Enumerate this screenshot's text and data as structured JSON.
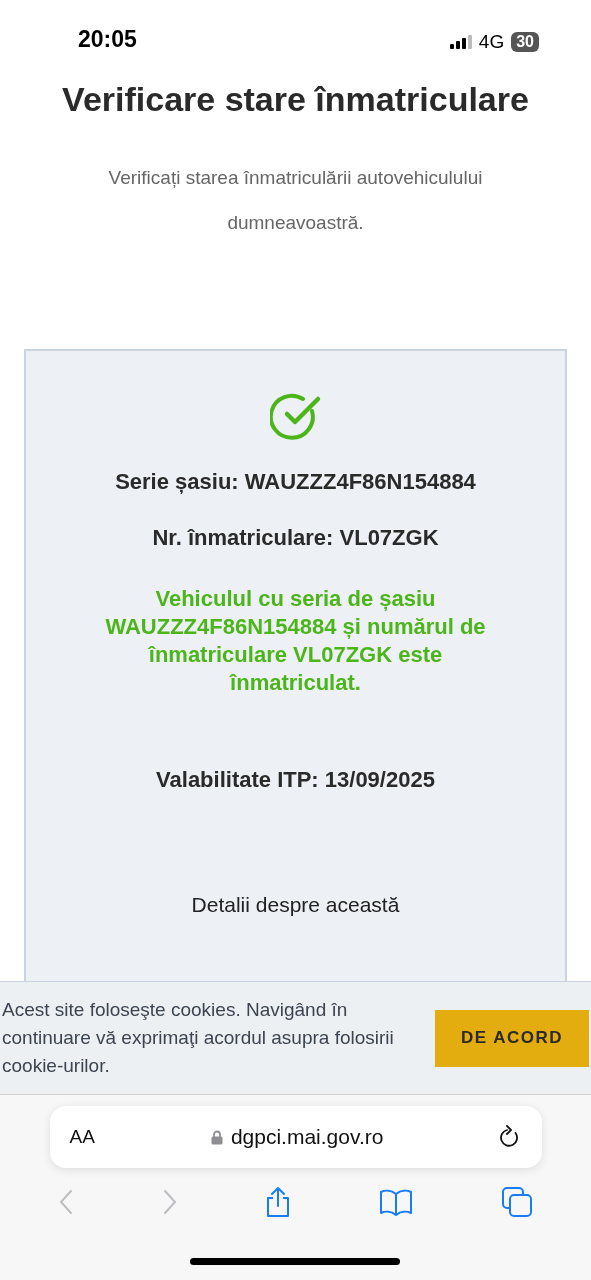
{
  "status_bar": {
    "time": "20:05",
    "network": "4G",
    "battery": "30"
  },
  "page": {
    "title": "Verificare stare înmatriculare",
    "subtitle": "Verificați starea înmatriculării autovehiculului dumneavoastră."
  },
  "result": {
    "registered": true,
    "chassis": "Serie șasiu: WAUZZZ4F86N154884",
    "plate": "Nr. înmatriculare: VL07ZGK",
    "message": "Vehiculul cu seria de șasiu WAUZZZ4F86N154884 și numărul de înmatriculare VL07ZGK este înmatriculat.",
    "itp": "Valabilitate ITP: 13/09/2025",
    "details": "Detalii despre această"
  },
  "cookie_banner": {
    "text": "Acest site foloseşte cookies. Navigând în continuare vă exprimaţi acordul asupra folosirii cookie-urilor.",
    "button": "DE ACORD"
  },
  "browser": {
    "text_size": "AA",
    "url": "dgpci.mai.gov.ro",
    "back_disabled": true,
    "forward_disabled": true
  }
}
